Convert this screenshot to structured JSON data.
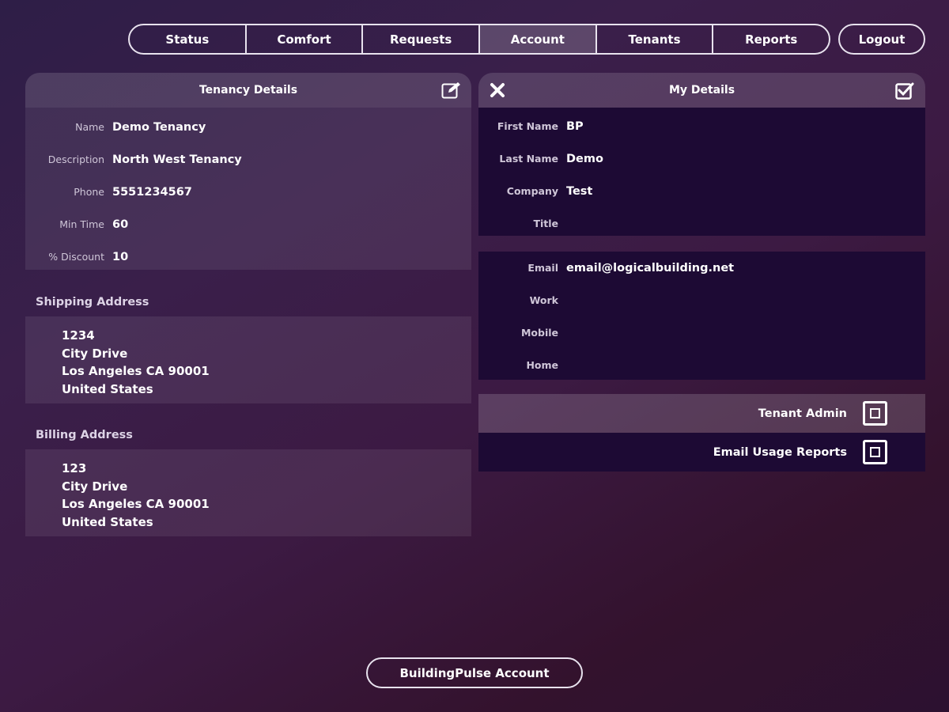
{
  "nav": {
    "tabs": [
      {
        "label": "Status"
      },
      {
        "label": "Comfort"
      },
      {
        "label": "Requests"
      },
      {
        "label": "Account",
        "active": true
      },
      {
        "label": "Tenants"
      },
      {
        "label": "Reports"
      }
    ],
    "logout_label": "Logout"
  },
  "tenancy": {
    "title": "Tenancy Details",
    "fields": [
      {
        "label": "Name",
        "value": "Demo Tenancy"
      },
      {
        "label": "Description",
        "value": "North West Tenancy"
      },
      {
        "label": "Phone",
        "value": "5551234567"
      },
      {
        "label": "Min Time",
        "value": "60"
      },
      {
        "label": "% Discount",
        "value": "10"
      }
    ]
  },
  "shipping": {
    "title": "Shipping Address",
    "lines": [
      "1234",
      "City Drive",
      "Los Angeles CA 90001",
      "United States"
    ]
  },
  "billing": {
    "title": "Billing Address",
    "lines": [
      "123",
      "City Drive",
      "Los Angeles CA 90001",
      "United States"
    ]
  },
  "my_details": {
    "title": "My Details",
    "fields": [
      {
        "label": "First Name",
        "value": "BP"
      },
      {
        "label": "Last Name",
        "value": "Demo"
      },
      {
        "label": "Company",
        "value": "Test"
      },
      {
        "label": "Title",
        "value": ""
      }
    ],
    "contact": [
      {
        "label": "Email",
        "value": "email@logicalbuilding.net"
      },
      {
        "label": "Work",
        "value": ""
      },
      {
        "label": "Mobile",
        "value": ""
      },
      {
        "label": "Home",
        "value": ""
      }
    ],
    "toggles": [
      {
        "label": "Tenant Admin",
        "checked": false
      },
      {
        "label": "Email Usage Reports",
        "checked": false
      }
    ]
  },
  "footer": {
    "button_label": "BuildingPulse Account"
  },
  "colors": {
    "accent_dark": "#1d0a34",
    "border": "#e8e2ee"
  },
  "icons": [
    "edit-icon",
    "close-icon",
    "checkbox-check-icon"
  ]
}
